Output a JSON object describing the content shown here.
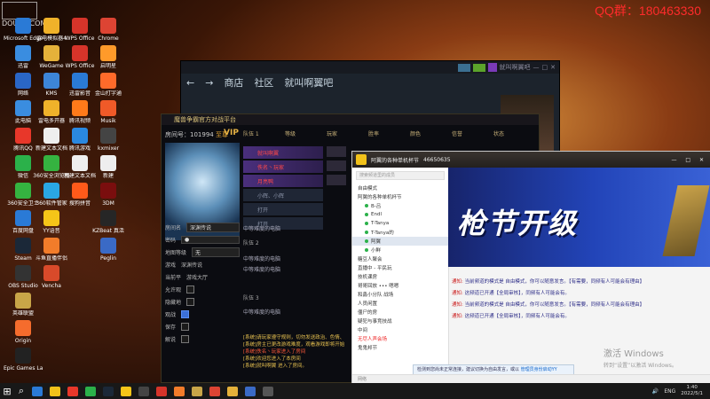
{
  "stream": {
    "qq_text": "QQ群：180463330",
    "site_logo": "DOUYU.COM"
  },
  "desktop_icons": [
    {
      "label": "Microsoft Edge",
      "col": 0,
      "row": 0,
      "color": "#2a7ad6"
    },
    {
      "label": "迅雷",
      "col": 0,
      "row": 1,
      "color": "#3a8de0"
    },
    {
      "label": "网络",
      "col": 0,
      "row": 2,
      "color": "#2a66c6"
    },
    {
      "label": "此电脑",
      "col": 0,
      "row": 3,
      "color": "#3a8de0"
    },
    {
      "label": "腾讯QQ",
      "col": 0,
      "row": 4,
      "color": "#e8372a"
    },
    {
      "label": "微信",
      "col": 0,
      "row": 5,
      "color": "#2bb14a"
    },
    {
      "label": "360安全卫士",
      "col": 0,
      "row": 6,
      "color": "#35b340"
    },
    {
      "label": "百度网盘",
      "col": 0,
      "row": 7,
      "color": "#2a7ad6"
    },
    {
      "label": "Steam",
      "col": 0,
      "row": 8,
      "color": "#1b2838"
    },
    {
      "label": "OBS Studio",
      "col": 0,
      "row": 9,
      "color": "#333333"
    },
    {
      "label": "英雄联盟",
      "col": 0,
      "row": 10,
      "color": "#c8a548"
    },
    {
      "label": "Origin",
      "col": 0,
      "row": 11,
      "color": "#f56c2d"
    },
    {
      "label": "Epic Games Launcher",
      "col": 0,
      "row": 12,
      "color": "#222222"
    },
    {
      "label": "雷电模拟器4",
      "col": 1,
      "row": 0,
      "color": "#f0b22a"
    },
    {
      "label": "WeGame",
      "col": 1,
      "row": 1,
      "color": "#e5b13a"
    },
    {
      "label": "KMS",
      "col": 1,
      "row": 2,
      "color": "#3d85d8"
    },
    {
      "label": "雷电多开器",
      "col": 1,
      "row": 3,
      "color": "#f0b22a"
    },
    {
      "label": "新建文本文档",
      "col": 1,
      "row": 4,
      "color": "#eeeeee"
    },
    {
      "label": "360安全浏览器",
      "col": 1,
      "row": 5,
      "color": "#35b340"
    },
    {
      "label": "360软件管家",
      "col": 1,
      "row": 6,
      "color": "#2aa6e3"
    },
    {
      "label": "YY语音",
      "col": 1,
      "row": 7,
      "color": "#f5c518"
    },
    {
      "label": "斗鱼直播伴侣",
      "col": 1,
      "row": 8,
      "color": "#f27c2a"
    },
    {
      "label": "Vencha",
      "col": 1,
      "row": 9,
      "color": "#d84a2a"
    },
    {
      "label": "WPS Office",
      "col": 2,
      "row": 0,
      "color": "#d6342a"
    },
    {
      "label": "WPS Office",
      "col": 2,
      "row": 1,
      "color": "#d6342a"
    },
    {
      "label": "迅雷影音",
      "col": 2,
      "row": 2,
      "color": "#2a7ad6"
    },
    {
      "label": "腾讯视频",
      "col": 2,
      "row": 3,
      "color": "#ff7a1a"
    },
    {
      "label": "腾讯游戏",
      "col": 2,
      "row": 4,
      "color": "#2a88e0"
    },
    {
      "label": "新建文本文档",
      "col": 2,
      "row": 5,
      "color": "#eeeeee"
    },
    {
      "label": "搜狗拼音",
      "col": 2,
      "row": 6,
      "color": "#ff5a1a"
    },
    {
      "label": "Chrome",
      "col": 3,
      "row": 0,
      "color": "#dd4433"
    },
    {
      "label": "启明星",
      "col": 3,
      "row": 1,
      "color": "#ff9a2a"
    },
    {
      "label": "金山打字通",
      "col": 3,
      "row": 2,
      "color": "#ff6a2a"
    },
    {
      "label": "Musik",
      "col": 3,
      "row": 3,
      "color": "#f05a28"
    },
    {
      "label": "kxmixer",
      "col": 3,
      "row": 4,
      "color": "#444444"
    },
    {
      "label": "新建",
      "col": 3,
      "row": 5,
      "color": "#eeeeee"
    },
    {
      "label": "3DM",
      "col": 3,
      "row": 6,
      "color": "#7a0e0e"
    },
    {
      "label": "KZBeat 真活",
      "col": 3,
      "row": 7,
      "color": "#262626"
    },
    {
      "label": "Peglin",
      "col": 3,
      "row": 8,
      "color": "#3a6ac6"
    }
  ],
  "steam": {
    "nav": [
      "商店",
      "社区",
      "就叫啊翼吧"
    ],
    "user": "就叫啊翼吧"
  },
  "platform": {
    "title": "魔兽争霸官方对战平台",
    "room_label": "房间号：101994",
    "room_tag": "至尊",
    "vip": "VIP",
    "columns": [
      "队伍 1",
      "等级",
      "玩家",
      "胜率",
      "颜色",
      "信誉",
      "状态"
    ],
    "team1": "队伍 1",
    "team2": "队伍 2",
    "team3": "队伍 3",
    "slots": [
      {
        "name": "就叫啊翼",
        "type": "p"
      },
      {
        "name": "佚名丶玩家",
        "type": "p"
      },
      {
        "name": "月亮鸭",
        "type": "p"
      },
      {
        "name": "小辉、小辉",
        "type": "open"
      },
      {
        "name": "打开",
        "type": "open"
      },
      {
        "name": "打开",
        "type": "open"
      }
    ],
    "waits": [
      "中等难度的电脑",
      "中等难度的电脑",
      "中等难度的电脑",
      "中等难度的电脑"
    ],
    "form": [
      {
        "label": "房间名",
        "value": "深渊传说"
      },
      {
        "label": "密码",
        "value": "●"
      },
      {
        "label": "地图等级",
        "value": "无"
      },
      {
        "label": "游戏",
        "value": "深渊传说"
      },
      {
        "label": "当前平",
        "value": "游戏大厅"
      }
    ],
    "checks": [
      {
        "label": "允许观",
        "on": false
      },
      {
        "label": "隐藏地",
        "on": false
      },
      {
        "label": "观战",
        "on": true
      },
      {
        "label": "保存",
        "on": false
      },
      {
        "label": "解说",
        "on": false
      }
    ],
    "log": [
      "[系统]请玩家遵守规则，切勿发送政治、色情、",
      "[系统]房主已更改游戏难度，观看游戏即将开始",
      "[系统]佚名丶玩家进入了房间",
      "[系统]欢迎您进入了本房间",
      "[系统]就叫啊翼 进入了房间。"
    ]
  },
  "yy": {
    "title": "阿翼的各种单机杯节",
    "channel": "46650635",
    "search_placeholder": "搜索频道里的成员",
    "tree": [
      {
        "text": "自由模式",
        "hl": false,
        "red": false,
        "dot": false
      },
      {
        "text": "阿翼的各种单机杯节",
        "hl": false,
        "red": false,
        "dot": false
      },
      {
        "text": "B-吕",
        "hl": false,
        "red": false,
        "dot": true
      },
      {
        "text": "Endl",
        "hl": false,
        "red": false,
        "dot": true
      },
      {
        "text": "T-Tanya",
        "hl": false,
        "red": false,
        "dot": true
      },
      {
        "text": "T-Tanya的",
        "hl": false,
        "red": false,
        "dot": true
      },
      {
        "text": "阿翼",
        "hl": true,
        "red": false,
        "dot": true
      },
      {
        "text": "小鲜",
        "hl": false,
        "red": false,
        "dot": true
      },
      {
        "text": "糖豆人聚会",
        "hl": false,
        "red": false,
        "dot": false
      },
      {
        "text": "直播中 - 平民玩",
        "hl": false,
        "red": false,
        "dot": false
      },
      {
        "text": "技机课房",
        "hl": false,
        "red": false,
        "dot": false
      },
      {
        "text": "哥哥回放 ••• 嗯嗯",
        "hl": false,
        "red": false,
        "dot": false
      },
      {
        "text": "和鑫小分队 战场",
        "hl": false,
        "red": false,
        "dot": false
      },
      {
        "text": "人员闲置",
        "hl": false,
        "red": false,
        "dot": false
      },
      {
        "text": "僵尸的房",
        "hl": false,
        "red": false,
        "dot": false
      },
      {
        "text": "疑犯与事竞技战",
        "hl": false,
        "red": false,
        "dot": false
      },
      {
        "text": "中间",
        "hl": false,
        "red": false,
        "dot": false
      },
      {
        "text": "无尽人声会场",
        "hl": false,
        "red": true,
        "dot": false
      },
      {
        "text": "鬼鬼邦节",
        "hl": false,
        "red": false,
        "dot": false
      }
    ],
    "banner_text": "枪节开级",
    "messages": [
      {
        "tag": "通知:",
        "text": "当前频道的模式是 自由模式，你可以随意发言。【有需要，同频有人可能会有理由】"
      },
      {
        "tag": "通知:",
        "text": "这频道已开通【全局审核】，同频有人可能会有。"
      },
      {
        "tag": "通知:",
        "text": "当前频道的模式是 自由模式，你可以随意发言。【有需要，同频有人可能会有理由】"
      },
      {
        "tag": "通知:",
        "text": "这频道已开通【全局审核】，同频有人可能会有。"
      }
    ],
    "notice_text": "检测到您尚未正常连接，建议切换为自由发言，或以",
    "notice_link": "管理员身份启动YY",
    "status_text": "网络"
  },
  "activate": {
    "line1": "激活 Windows",
    "line2": "转到“设置”以激活 Windows。"
  },
  "taskbar": {
    "apps": [
      {
        "name": "edge",
        "color": "#2a7ad6"
      },
      {
        "name": "explorer",
        "color": "#f2c21a"
      },
      {
        "name": "qq",
        "color": "#e8372a"
      },
      {
        "name": "wechat",
        "color": "#2bb14a"
      },
      {
        "name": "steam",
        "color": "#1b2838"
      },
      {
        "name": "yy",
        "color": "#f5c518"
      },
      {
        "name": "obs",
        "color": "#444444"
      },
      {
        "name": "wps",
        "color": "#d6342a"
      },
      {
        "name": "douyu",
        "color": "#f27c2a"
      },
      {
        "name": "war3",
        "color": "#c8a548"
      },
      {
        "name": "chrome",
        "color": "#dd4433"
      },
      {
        "name": "folder",
        "color": "#e5b13a"
      },
      {
        "name": "photos",
        "color": "#3a6ac6"
      },
      {
        "name": "terminal",
        "color": "#555555"
      }
    ],
    "lang": "ENG",
    "time": "1:40",
    "date": "2022/5/1"
  }
}
